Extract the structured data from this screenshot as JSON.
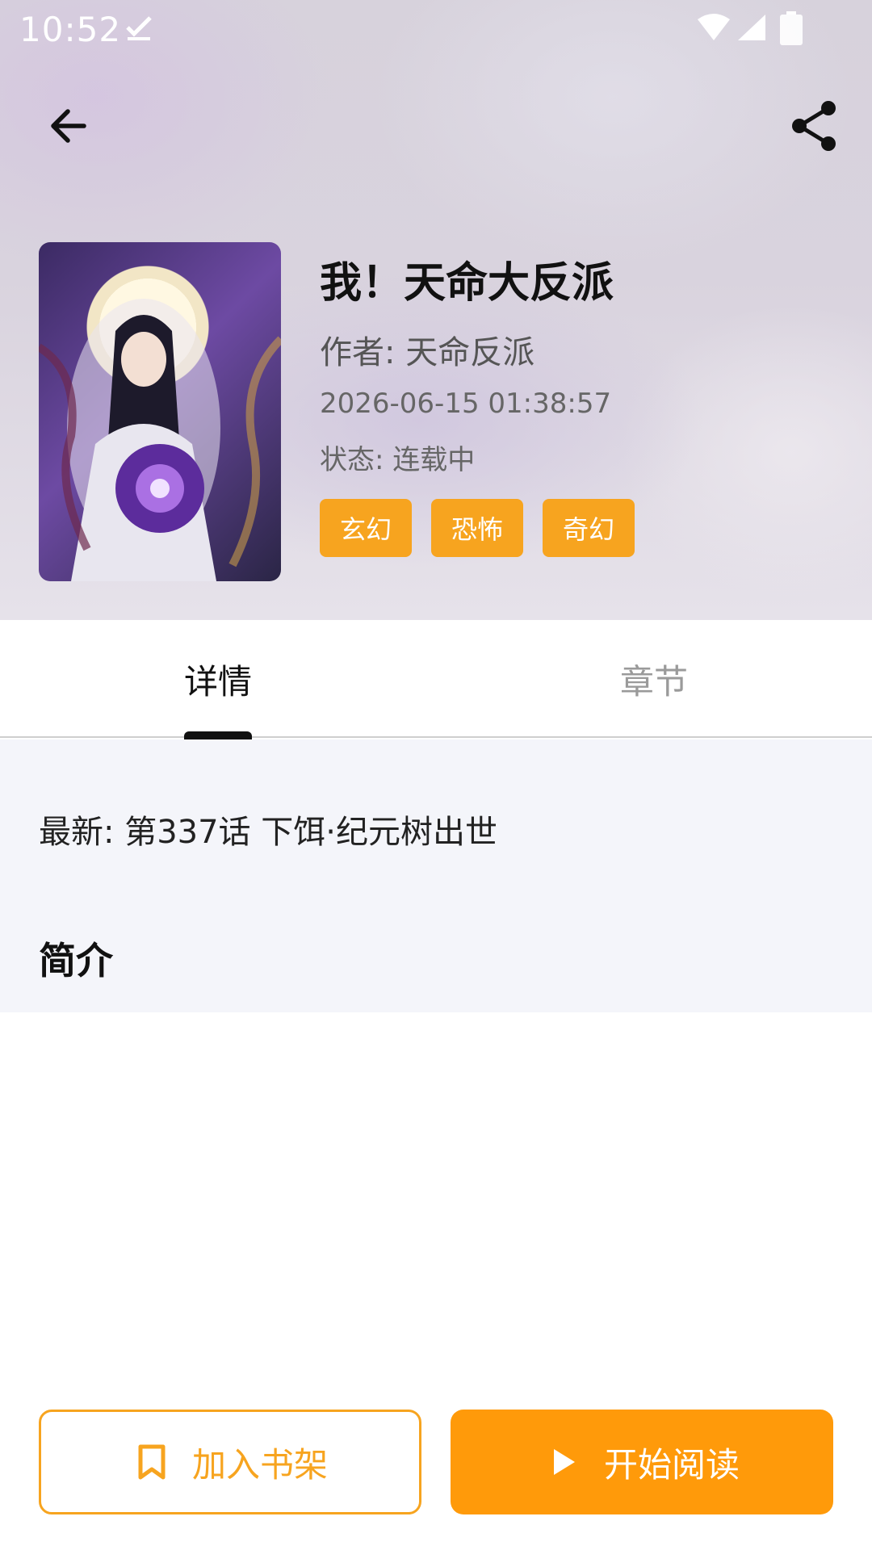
{
  "status_bar": {
    "time": "10:52"
  },
  "header": {
    "back_icon": "arrow-left-icon",
    "share_icon": "share-icon"
  },
  "book": {
    "title": "我！天命大反派",
    "author": "作者: 天命反派",
    "updated": "2026-06-15 01:38:57",
    "status": "状态: 连载中",
    "tags": [
      "玄幻",
      "恐怖",
      "奇幻"
    ]
  },
  "tabs": [
    {
      "label": "详情",
      "active": true
    },
    {
      "label": "章节",
      "active": false
    }
  ],
  "detail": {
    "latest": "最新: 第337话 下饵·纪元树出世",
    "intro_title": "简介"
  },
  "actions": {
    "add_shelf": "加入书架",
    "start_read": "开始阅读"
  },
  "colors": {
    "accent": "#f7a41f",
    "primary_button": "#ff9a0a",
    "content_bg": "#f4f5fa"
  }
}
